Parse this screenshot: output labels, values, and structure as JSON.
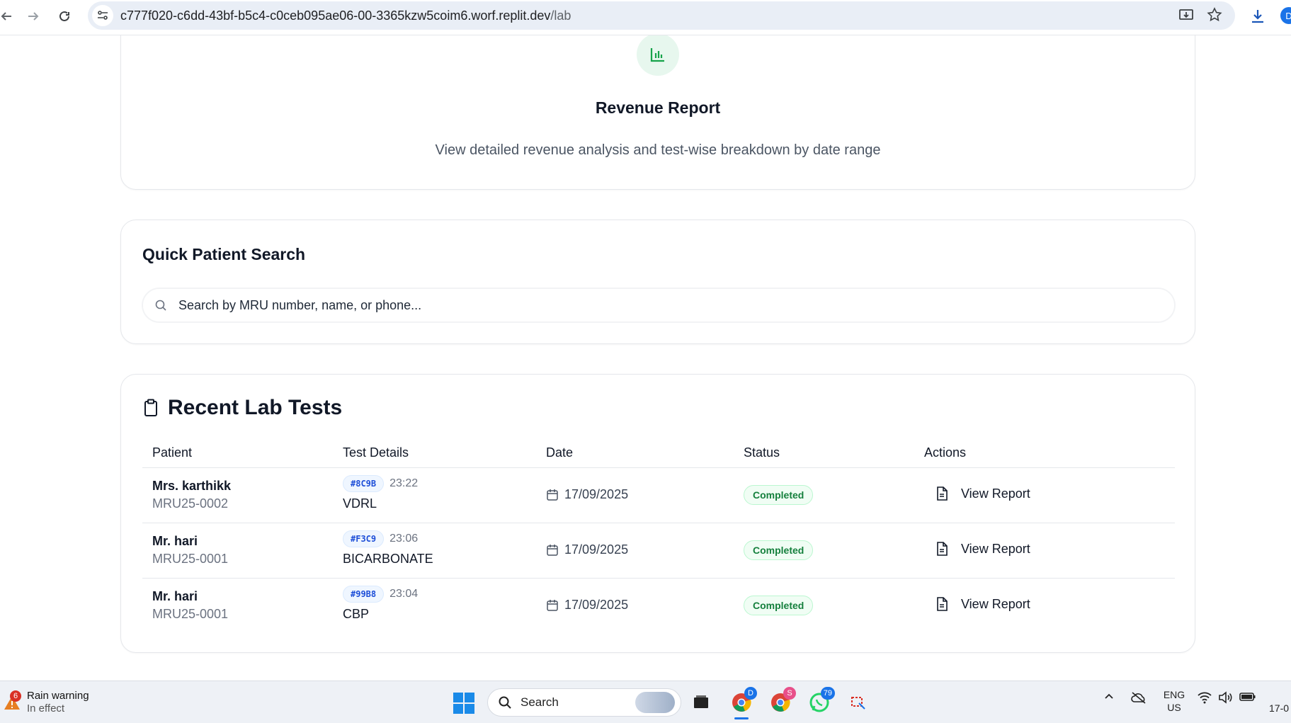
{
  "browser": {
    "url_host": "c777f020-c6dd-43bf-b5c4-c0ceb095ae06-00-3365kzw5coim6.worf.replit.dev",
    "url_path": "/lab",
    "profile_initial": "D"
  },
  "revenue_card": {
    "title": "Revenue Report",
    "description": "View detailed revenue analysis and test-wise breakdown by date range",
    "icon": "bar-chart-icon"
  },
  "search": {
    "title": "Quick Patient Search",
    "placeholder": "Search by MRU number, name, or phone..."
  },
  "recent_tests": {
    "title": "Recent Lab Tests",
    "columns": [
      "Patient",
      "Test Details",
      "Date",
      "Status",
      "Actions"
    ],
    "rows": [
      {
        "patient_name": "Mrs. karthikk",
        "mru": "MRU25-0002",
        "code": "#8C9B",
        "time": "23:22",
        "test": "VDRL",
        "date": "17/09/2025",
        "status": "Completed",
        "action": "View Report"
      },
      {
        "patient_name": "Mr. hari",
        "mru": "MRU25-0001",
        "code": "#F3C9",
        "time": "23:06",
        "test": "BICARBONATE",
        "date": "17/09/2025",
        "status": "Completed",
        "action": "View Report"
      },
      {
        "patient_name": "Mr. hari",
        "mru": "MRU25-0001",
        "code": "#99B8",
        "time": "23:04",
        "test": "CBP",
        "date": "17/09/2025",
        "status": "Completed",
        "action": "View Report"
      }
    ]
  },
  "taskbar": {
    "weather_title": "Rain warning",
    "weather_sub": "In effect",
    "weather_badge": "6",
    "search_label": "Search",
    "chrome_badge_1": "D",
    "chrome_badge_2": "S",
    "whatsapp_badge": "79",
    "lang_line1": "ENG",
    "lang_line2": "US",
    "clock": "17-0"
  },
  "colors": {
    "accent_green": "#16a34a",
    "status_green": "#15803d",
    "badge_blue": "#1d4ed8"
  }
}
